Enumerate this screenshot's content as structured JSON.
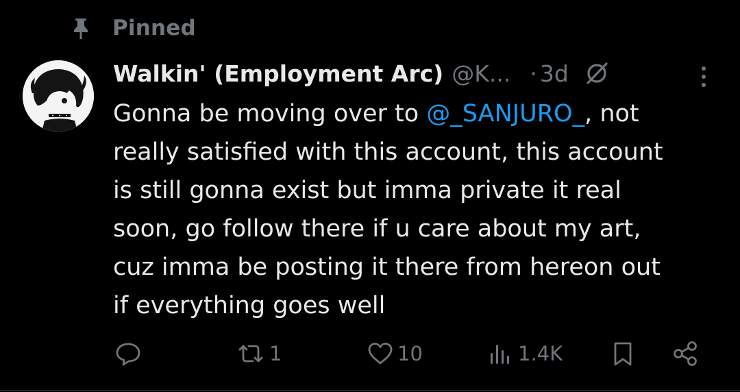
{
  "pinned": {
    "label": "Pinned",
    "icon": "pin-icon"
  },
  "post": {
    "display_name": "Walkin' (Employment Arc)",
    "handle": "@K...",
    "separator": "·",
    "time": "3d",
    "body_lines": {
      "line1_prefix": "Gonna be moving over to ",
      "line1_mention": "@_SANJURO_",
      "line1_suffix": ", not",
      "line2": "really satisfied with this account, this account",
      "line3": "is still gonna exist but imma private it real",
      "line4": "soon, go follow there if u care about my art,",
      "line5": "cuz imma be posting it there from hereon out",
      "line6": "if everything goes well"
    }
  },
  "actions": {
    "reply_count": "",
    "repost_count": "1",
    "like_count": "10",
    "views_count": "1.4K"
  },
  "colors": {
    "background": "#000000",
    "text_primary": "#e7e9ea",
    "text_secondary": "#71767b",
    "mention": "#1d9bf0"
  },
  "icons": [
    "pin-icon",
    "grok-icon",
    "more-icon",
    "reply-icon",
    "repost-icon",
    "like-icon",
    "views-icon",
    "bookmark-icon",
    "share-icon"
  ]
}
